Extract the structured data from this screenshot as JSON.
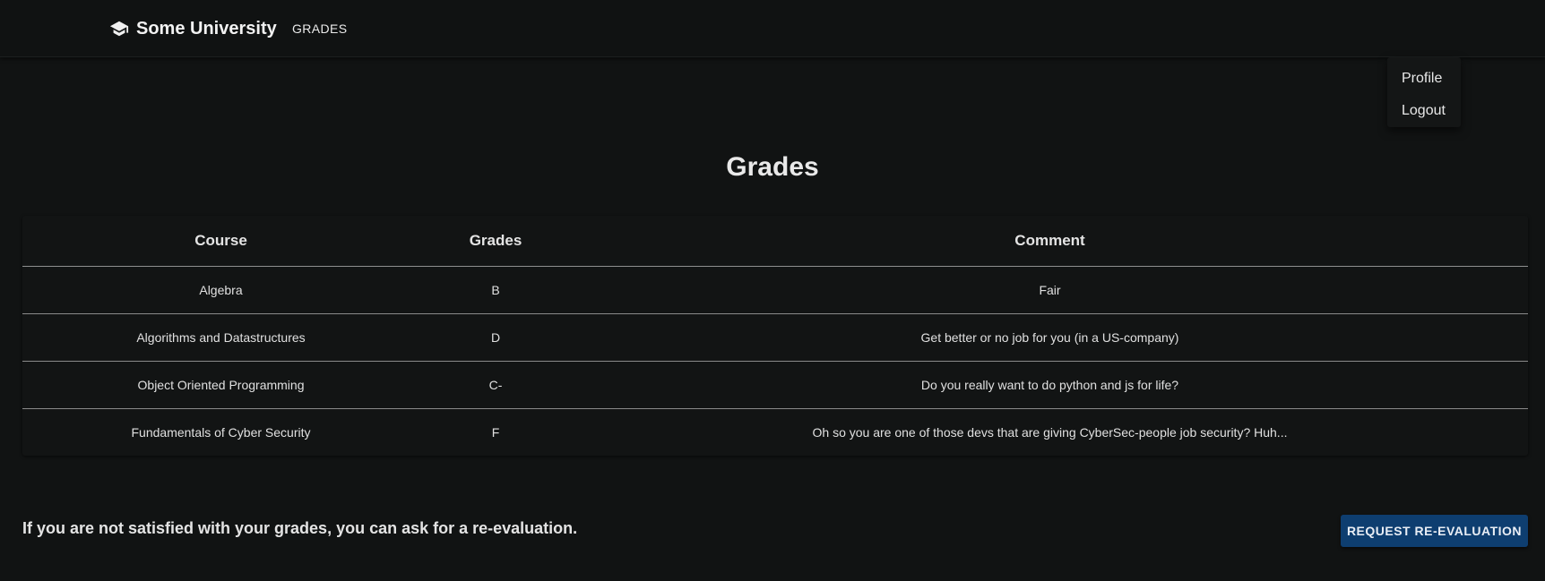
{
  "header": {
    "brand_icon": "graduation-cap-icon",
    "brand_name": "Some University",
    "nav_grades": "GRADES"
  },
  "user_menu": {
    "items": [
      {
        "label": "Profile"
      },
      {
        "label": "Logout"
      }
    ]
  },
  "main": {
    "title": "Grades",
    "table": {
      "headers": [
        "Course",
        "Grades",
        "Comment"
      ],
      "rows": [
        {
          "course": "Algebra",
          "grade": "B",
          "comment": "Fair"
        },
        {
          "course": "Algorithms and Datastructures",
          "grade": "D",
          "comment": "Get better or no job for you (in a US-company)"
        },
        {
          "course": "Object Oriented Programming",
          "grade": "C-",
          "comment": "Do you really want to do python and js for life?"
        },
        {
          "course": "Fundamentals of Cyber Security",
          "grade": "F",
          "comment": "Oh so you are one of those devs that are giving CyberSec-people job security? Huh..."
        }
      ]
    },
    "footer_text": "If you are not satisfied with your grades, you can ask for a re-evaluation.",
    "reeval_button": "REQUEST RE-EVALUATION"
  },
  "colors": {
    "background": "#111313",
    "button": "#0e3e70"
  }
}
